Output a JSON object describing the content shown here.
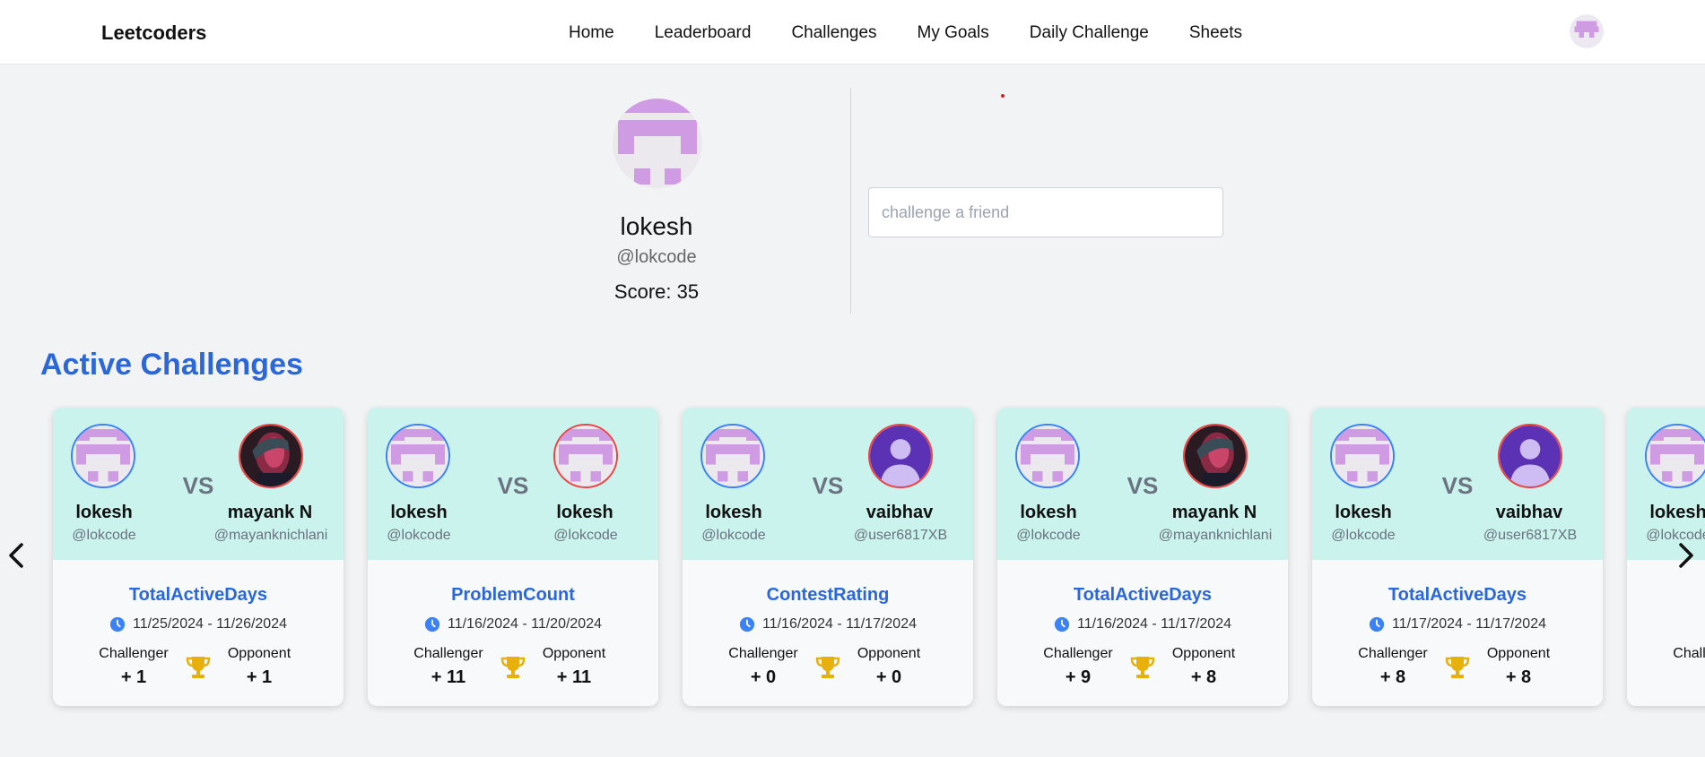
{
  "nav": {
    "brand": "Leetcoders",
    "links": [
      "Home",
      "Leaderboard",
      "Challenges",
      "My Goals",
      "Daily Challenge",
      "Sheets"
    ]
  },
  "profile": {
    "name": "lokesh",
    "handle": "@lokcode",
    "score": "Score: 35"
  },
  "search": {
    "placeholder": "challenge a friend"
  },
  "active": {
    "title": "Active Challenges",
    "challenger_label": "Challenger",
    "opponent_label": "Opponent",
    "vs_label": "VS"
  },
  "colors": {
    "accent": "#2b67d8",
    "card_top": "#c9f3ec",
    "challenger_ring": "#3b82f6",
    "opponent_ring": "#ef4444",
    "trophy": "#e8b00a"
  },
  "cards": [
    {
      "left": {
        "name": "lokesh",
        "handle": "@lokcode",
        "avatar": "pixel-avatar"
      },
      "right": {
        "name": "mayank N",
        "handle": "@mayanknichlani",
        "avatar": "photo-avatar"
      },
      "type": "TotalActiveDays",
      "dates": "11/25/2024 - 11/26/2024",
      "challenger_score": "+ 1",
      "opponent_score": "+ 1"
    },
    {
      "left": {
        "name": "lokesh",
        "handle": "@lokcode",
        "avatar": "pixel-avatar"
      },
      "right": {
        "name": "lokesh",
        "handle": "@lokcode",
        "avatar": "pixel-avatar"
      },
      "type": "ProblemCount",
      "dates": "11/16/2024 - 11/20/2024",
      "challenger_score": "+ 11",
      "opponent_score": "+ 11"
    },
    {
      "left": {
        "name": "lokesh",
        "handle": "@lokcode",
        "avatar": "pixel-avatar"
      },
      "right": {
        "name": "vaibhav",
        "handle": "@user6817XB",
        "avatar": "default-user-avatar"
      },
      "type": "ContestRating",
      "dates": "11/16/2024 - 11/17/2024",
      "challenger_score": "+ 0",
      "opponent_score": "+ 0"
    },
    {
      "left": {
        "name": "lokesh",
        "handle": "@lokcode",
        "avatar": "pixel-avatar"
      },
      "right": {
        "name": "mayank N",
        "handle": "@mayanknichlani",
        "avatar": "photo-avatar"
      },
      "type": "TotalActiveDays",
      "dates": "11/16/2024 - 11/17/2024",
      "challenger_score": "+ 9",
      "opponent_score": "+ 8"
    },
    {
      "left": {
        "name": "lokesh",
        "handle": "@lokcode",
        "avatar": "pixel-avatar"
      },
      "right": {
        "name": "vaibhav",
        "handle": "@user6817XB",
        "avatar": "default-user-avatar"
      },
      "type": "TotalActiveDays",
      "dates": "11/17/2024 - 11/17/2024",
      "challenger_score": "+ 8",
      "opponent_score": "+ 8"
    },
    {
      "left": {
        "name": "lokesh",
        "handle": "@lokcode",
        "avatar": "pixel-avatar"
      },
      "right": {
        "name": "",
        "handle": "",
        "avatar": ""
      },
      "type": "",
      "dates": "",
      "challenger_score": "",
      "opponent_score": ""
    }
  ]
}
